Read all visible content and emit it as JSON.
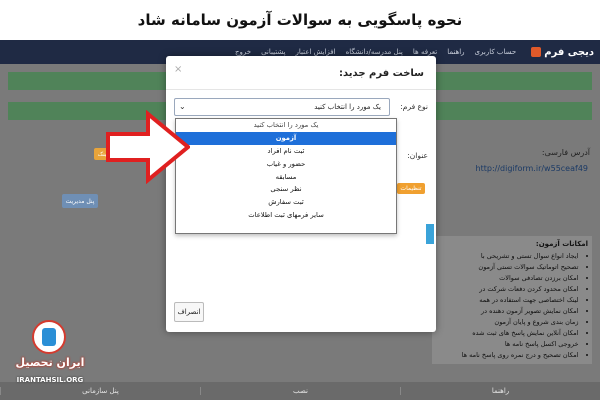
{
  "banner": {
    "title": "نحوه پاسگویی به سوالات آزمون سامانه شاد"
  },
  "topnav": {
    "brand": "دیجی فرم",
    "items": [
      "حساب کاربری",
      "راهنما",
      "تعرفه ها",
      "پنل مدرسه/دانشگاه",
      "افزایش اعتبار",
      "پشتیبانی",
      "خروج"
    ]
  },
  "page": {
    "address_label": "آدرس فارسی:",
    "url": "http://digiform.ir/w55ceaf49",
    "copy_label": "کپی لینک",
    "manage_label": "پنل مدیریت",
    "features_title": "امکانات آزمون:",
    "features": [
      "ایجاد انواع سوال تستی و تشریحی با",
      "تصحیح اتوماتیک سوالات تستی آزمون",
      "امکان برزدن تصادفی سوالات",
      "امکان محدود کردن دفعات شرکت در",
      "لینک اختصاصی جهت استفاده در همه",
      "امکان نمایش تصویر آزمون دهنده در",
      "زمان بندی شروع و پایان آزمون",
      "امکان آنلاین نمایش پاسخ های ثبت شده",
      "خروجی اکسل پاسخ نامه ها",
      "امکان تصحیح و درج نمره روی پاسخ نامه ها"
    ],
    "bottom_items": [
      "راهنما",
      "نصب",
      "پنل سازمانی"
    ]
  },
  "modal": {
    "title": "ساخت فرم جدید:",
    "close": "×",
    "type_label": "نوع فرم:",
    "select_value": "یک مورد را انتخاب کنید",
    "title_label": "عنوان:",
    "warn_label": "تنظیمات",
    "cancel_label": "انصراف"
  },
  "dropdown": {
    "options": [
      "یک مورد را انتخاب کنید",
      "آزمون",
      "ثبت نام افراد",
      "حضور و غیاب",
      "مسابقه",
      "نظر سنجی",
      "ثبت سفارش",
      "سایر فرمهای ثبت اطلاعات"
    ],
    "selected_index": 1
  },
  "watermark": {
    "name": "ایران تحصیل",
    "site": "IRANTAHSIL.ORG"
  },
  "colors": {
    "nav": "#1f2a44",
    "overlay": "#7a7a7a",
    "selected": "#1e6fd9",
    "arrow": "#e02020"
  }
}
